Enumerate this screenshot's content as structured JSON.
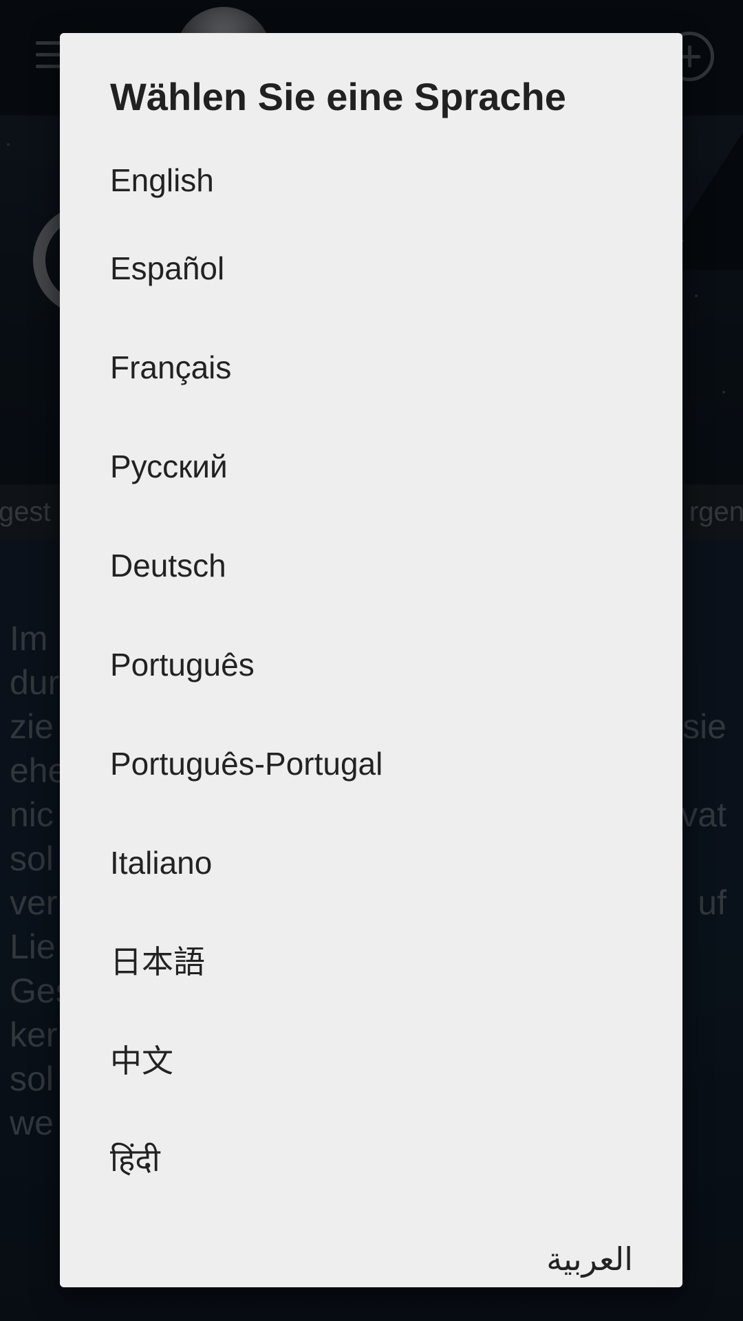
{
  "background": {
    "date_left": "gest",
    "date_right": "rgen",
    "text_left": [
      "Im",
      "dur",
      "zie",
      "ehe",
      "nic",
      "sol",
      "ver",
      "Lie",
      "Ges",
      "ker",
      "sol",
      "we"
    ],
    "text_right": [
      "sie",
      "vat",
      "uf"
    ]
  },
  "dialog": {
    "title": "Wählen Sie eine Sprache",
    "languages": [
      "English",
      "Español",
      "Français",
      "Русский",
      "Deutsch",
      "Português",
      "Português-Portugal",
      "Italiano",
      "日本語",
      "中文",
      "हिंदी",
      "العربية"
    ]
  },
  "colors": {
    "dialog_background": "#eeeeef",
    "text": "#222222",
    "app_background": "#0f1a25"
  },
  "icons": [
    "menu-icon",
    "add-icon"
  ]
}
